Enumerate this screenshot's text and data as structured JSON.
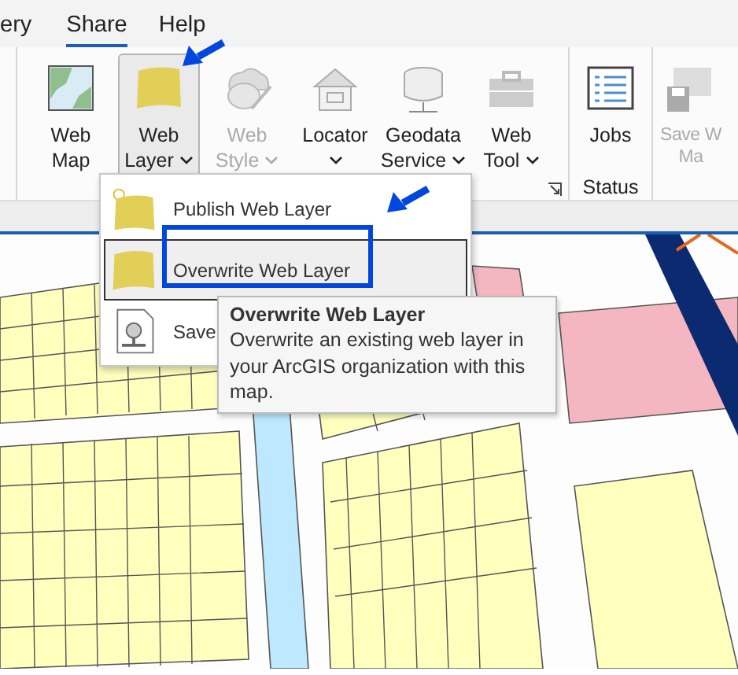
{
  "ribbon_tabs": [
    {
      "label": "ery",
      "selected": false
    },
    {
      "label": "Share",
      "selected": true
    },
    {
      "label": "Help",
      "selected": false
    }
  ],
  "ribbon_groups": [
    {
      "launcher": true,
      "buttons": [
        {
          "lines": [
            "Web",
            "Map"
          ],
          "dropdown": false,
          "disabled": false,
          "pressed": false
        },
        {
          "lines": [
            "Web",
            "Layer"
          ],
          "dropdown": true,
          "disabled": false,
          "pressed": true
        },
        {
          "lines": [
            "Web",
            "Style"
          ],
          "dropdown": true,
          "disabled": true,
          "pressed": false
        },
        {
          "lines": [
            "Locator"
          ],
          "dropdown": true,
          "disabled": false,
          "pressed": false
        },
        {
          "lines": [
            "Geodata",
            "Service"
          ],
          "dropdown": true,
          "disabled": false,
          "pressed": false
        },
        {
          "lines": [
            "Web",
            "Tool"
          ],
          "dropdown": true,
          "disabled": false,
          "pressed": false
        }
      ]
    },
    {
      "label": "Status",
      "buttons": [
        {
          "lines": [
            "Jobs"
          ],
          "dropdown": false,
          "disabled": false,
          "pressed": false
        }
      ]
    },
    {
      "buttons": [
        {
          "lines": [
            "Save W",
            "Ma"
          ],
          "dropdown": false,
          "disabled": true,
          "pressed": false
        }
      ]
    }
  ],
  "dropdown_menu": [
    {
      "label": "Publish Web Layer",
      "selected": false
    },
    {
      "label": "Overwrite Web Layer",
      "selected": true
    },
    {
      "label": "Save",
      "selected": false
    }
  ],
  "tooltip": {
    "title": "Overwrite Web Layer",
    "text": "Overwrite an existing web layer in your ArcGIS organization with this map."
  }
}
